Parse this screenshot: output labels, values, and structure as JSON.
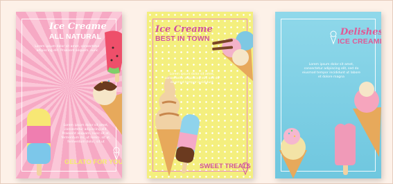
{
  "cards": [
    {
      "title": "Ice Creame",
      "subtitle": "ALL NATURAL",
      "body_top": "Lorem ipsum dolor sit amet, consectetur adipiscing elit. Praesent aliquam, nunc",
      "body_bottom": "Lorem ipsum dolor sit amet, consectetur adipiscing elit. Praesent aliquam, nunc sit at, fermentum mi, ut lorem. sit at, fermentum dolor, sit ut",
      "footer": "GELATO FOR YOU",
      "accent": "#ffffff"
    },
    {
      "title": "Ice Creame",
      "subtitle": "BEST IN TOWN",
      "body": "Lorem ipsum dolor sit amet, consectetur adipiscing elit, sed do eiusmod tempor incididunt",
      "footer": "SWEET TREATS",
      "accent": "#d2559a"
    },
    {
      "title": "Delishes",
      "subtitle": "ICE CREAME",
      "body": "Lorem ipsum dolor sit amet, consectetur adipiscing elit, sed do eiusmod tempor incididunt ut labore et dolore magna",
      "accent": "#e05a95"
    }
  ]
}
